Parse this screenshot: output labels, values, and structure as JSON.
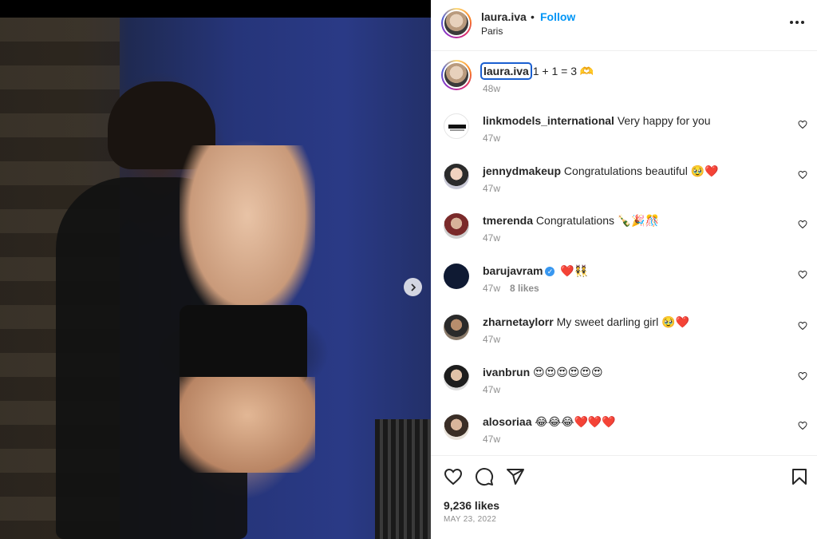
{
  "post": {
    "author": "laura.iva",
    "separator": "•",
    "follow_label": "Follow",
    "location": "Paris",
    "caption": {
      "username": "laura.iva",
      "text": " 1 + 1 = 3 🫶",
      "time": "48w"
    },
    "likes": "9,236 likes",
    "date": "MAY 23, 2022"
  },
  "comments": [
    {
      "username": "linkmodels_international",
      "text": " Very happy for you",
      "time": "47w",
      "likes": ""
    },
    {
      "username": "jennydmakeup",
      "text": " Congratulations beautiful 🥹❤️",
      "time": "47w",
      "likes": ""
    },
    {
      "username": "tmerenda",
      "text": " Congratulations 🍾🎉🎊",
      "time": "47w",
      "likes": ""
    },
    {
      "username": "barujavram",
      "text": " ❤️👯",
      "time": "47w",
      "likes": "8 likes",
      "verified": true
    },
    {
      "username": "zharnetaylorr",
      "text": " My sweet darling girl 🥹❤️",
      "time": "47w",
      "likes": ""
    },
    {
      "username": "ivanbrun",
      "text": " 😍😍😍😍😍😍",
      "time": "47w",
      "likes": ""
    },
    {
      "username": "alosoriaa",
      "text": " 😂😂😂❤️❤️❤️",
      "time": "47w",
      "likes": ""
    }
  ],
  "icons": {
    "more": "more-options-icon",
    "next": "chevron-right-icon",
    "like": "heart-icon",
    "comment": "comment-icon",
    "share": "share-icon",
    "save": "bookmark-icon",
    "verified": "verified-badge-icon"
  },
  "colors": {
    "follow": "#0095f6",
    "text": "#262626",
    "muted": "#8e8e8e",
    "verified": "#3897f0"
  }
}
